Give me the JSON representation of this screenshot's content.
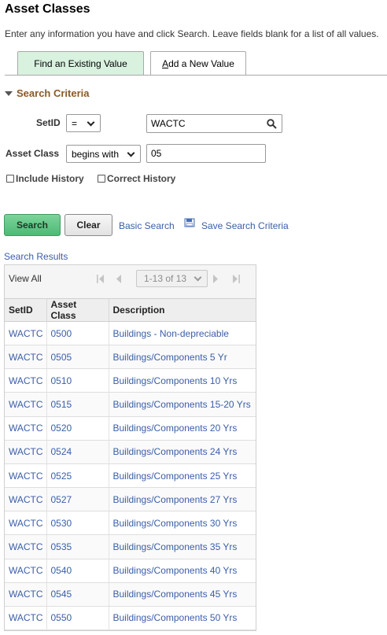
{
  "page": {
    "title": "Asset Classes",
    "instructions": "Enter any information you have and click Search. Leave fields blank for a list of all values."
  },
  "tabs": {
    "find_label": "Find an Existing Value",
    "add_label_hotkey": "A",
    "add_label_rest": "dd a New Value"
  },
  "criteria": {
    "header": "Search Criteria",
    "setid_label": "SetID",
    "setid_operator": "=",
    "setid_value": "WACTC",
    "asset_class_label": "Asset Class",
    "asset_class_operator": "begins with",
    "asset_class_value": "05",
    "include_history_label": "Include History",
    "correct_history_label": "Correct History"
  },
  "actions": {
    "search_label": "Search",
    "clear_label": "Clear",
    "basic_search_label": "Basic Search",
    "save_search_label": "Save Search Criteria"
  },
  "results": {
    "title": "Search Results",
    "view_all_label": "View All",
    "page_indicator": "1-13 of 13",
    "columns": [
      "SetID",
      "Asset Class",
      "Description"
    ],
    "rows": [
      {
        "setid": "WACTC",
        "asset_class": "0500",
        "description": "Buildings - Non-depreciable"
      },
      {
        "setid": "WACTC",
        "asset_class": "0505",
        "description": "Buildings/Components 5 Yr"
      },
      {
        "setid": "WACTC",
        "asset_class": "0510",
        "description": "Buildings/Components 10 Yrs"
      },
      {
        "setid": "WACTC",
        "asset_class": "0515",
        "description": "Buildings/Components 15-20 Yrs"
      },
      {
        "setid": "WACTC",
        "asset_class": "0520",
        "description": "Buildings/Components 20 Yrs"
      },
      {
        "setid": "WACTC",
        "asset_class": "0524",
        "description": "Buildings/Components 24 Yrs"
      },
      {
        "setid": "WACTC",
        "asset_class": "0525",
        "description": "Buildings/Components 25 Yrs"
      },
      {
        "setid": "WACTC",
        "asset_class": "0527",
        "description": "Buildings/Components 27 Yrs"
      },
      {
        "setid": "WACTC",
        "asset_class": "0530",
        "description": "Buildings/Components 30 Yrs"
      },
      {
        "setid": "WACTC",
        "asset_class": "0535",
        "description": "Buildings/Components 35 Yrs"
      },
      {
        "setid": "WACTC",
        "asset_class": "0540",
        "description": "Buildings/Components 40 Yrs"
      },
      {
        "setid": "WACTC",
        "asset_class": "0545",
        "description": "Buildings/Components 45 Yrs"
      },
      {
        "setid": "WACTC",
        "asset_class": "0550",
        "description": "Buildings/Components 50 Yrs"
      }
    ]
  },
  "colors": {
    "link": "#3b5ea8",
    "section_header": "#8a5a28",
    "active_tab": "#d9f2e0",
    "search_button": "#4dba75"
  },
  "icons": {
    "search_field": "magnifier-icon",
    "save_search": "save-search-icon",
    "collapse": "triangle-down-icon",
    "first_page": "first-page-icon",
    "previous_page": "previous-page-icon",
    "next_page": "next-page-icon",
    "last_page": "last-page-icon"
  }
}
